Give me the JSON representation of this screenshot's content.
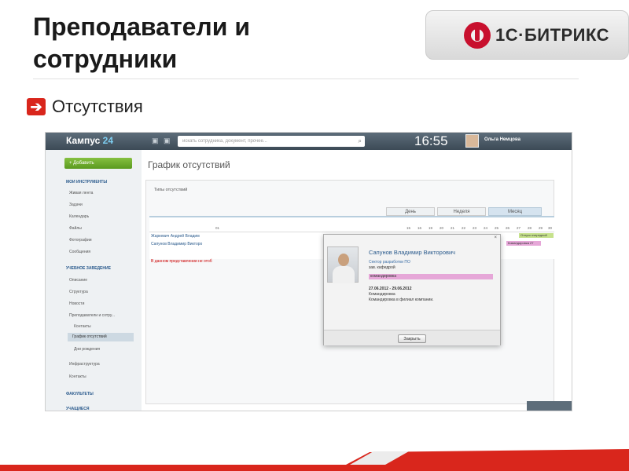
{
  "slide": {
    "title": "Преподаватели и сотрудники",
    "subtitle": "Отсутствия",
    "logo_text": "1С·БИТРИКС",
    "brand_color": "#c8102e"
  },
  "app": {
    "brand_main": "Кампус",
    "brand_num": "24",
    "search_placeholder": "искать сотрудника, документ, прочее...",
    "clock": "16:55",
    "user_name": "Ольга Немцова"
  },
  "sidebar": {
    "add_label": "+ Добавить",
    "section_tools": "МОИ ИНСТРУМЕНТЫ",
    "tools": [
      "Живая лента",
      "Задачи",
      "Календарь",
      "Файлы",
      "Фотографии",
      "Сообщения"
    ],
    "section_school": "УЧЕБНОЕ ЗАВЕДЕНИЕ",
    "school": [
      "Описание",
      "Структура",
      "Новости",
      "Преподаватели и сотру...",
      "Контакты",
      "График отсутствий",
      "Дни рождения",
      "Инфраструктура",
      "Контакты"
    ],
    "section_fac": "ФАКУЛЬТЕТЫ",
    "section_students": "УЧАЩИЕСЯ"
  },
  "content": {
    "title": "График отсутствий",
    "filter": "Типы отсутствий",
    "tabs": [
      "День",
      "Неделя",
      "Месяц"
    ],
    "header_days": [
      "01",
      "15",
      "16",
      "19",
      "20",
      "21",
      "22",
      "23",
      "24",
      "25",
      "26",
      "27",
      "28",
      "29",
      "30"
    ],
    "rows": [
      {
        "name": "Жаркевич Андрей Владим",
        "bar": "Отпуск очередной"
      },
      {
        "name": "Сапунов Владимир Викторо",
        "bar": "Командировка 27"
      }
    ],
    "note": "В данном представлении не отоб"
  },
  "popup": {
    "close": "×",
    "name": "Сапунов Владимир Викторович",
    "department": "Сектор разработки ПО",
    "position": "зав. кафедрой",
    "type": "командировка",
    "dates": "27.06.2012 - 29.06.2012",
    "line1": "Командировка",
    "line2": "Командировка в филиал компании.",
    "button": "Закрыть"
  }
}
